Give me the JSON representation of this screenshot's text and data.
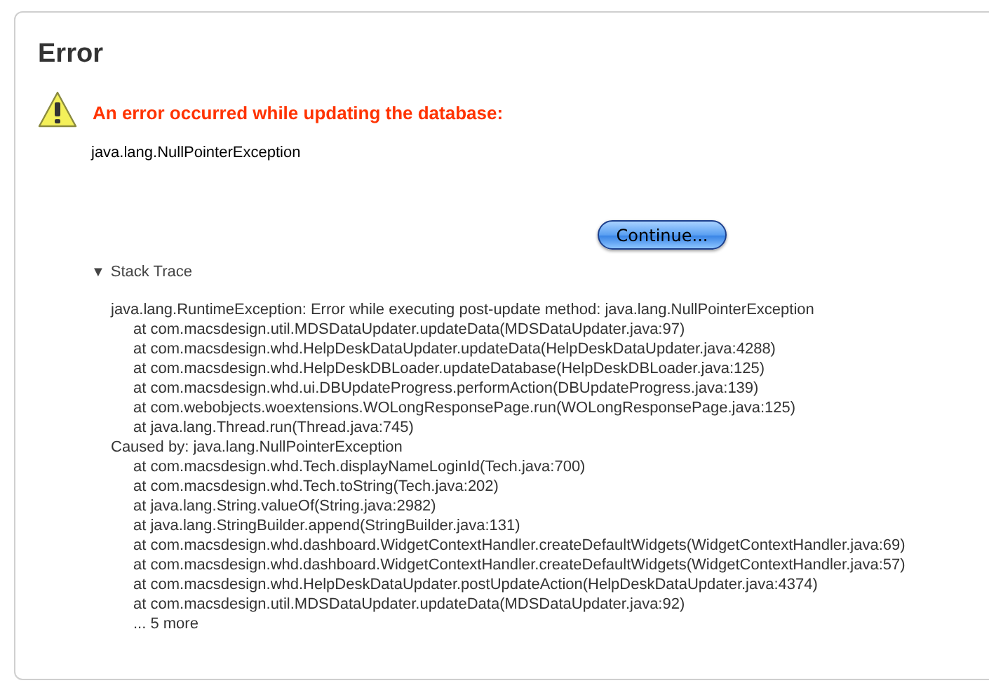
{
  "title": "Error",
  "alert": {
    "message": "An error occurred while updating the database:",
    "detail": "java.lang.NullPointerException"
  },
  "button": "Continue...",
  "stack_trace": {
    "toggle": "▼",
    "label": "Stack Trace",
    "expanded": true,
    "lines": [
      {
        "kind": "exception",
        "text": "java.lang.RuntimeException: Error while executing post-update method: java.lang.NullPointerException"
      },
      {
        "kind": "frame",
        "text": "at com.macsdesign.util.MDSDataUpdater.updateData(MDSDataUpdater.java:97)"
      },
      {
        "kind": "frame",
        "text": "at com.macsdesign.whd.HelpDeskDataUpdater.updateData(HelpDeskDataUpdater.java:4288)"
      },
      {
        "kind": "frame",
        "text": "at com.macsdesign.whd.HelpDeskDBLoader.updateDatabase(HelpDeskDBLoader.java:125)"
      },
      {
        "kind": "frame",
        "text": "at com.macsdesign.whd.ui.DBUpdateProgress.performAction(DBUpdateProgress.java:139)"
      },
      {
        "kind": "frame",
        "text": "at com.webobjects.woextensions.WOLongResponsePage.run(WOLongResponsePage.java:125)"
      },
      {
        "kind": "frame",
        "text": "at java.lang.Thread.run(Thread.java:745)"
      },
      {
        "kind": "exception",
        "text": "Caused by: java.lang.NullPointerException"
      },
      {
        "kind": "frame",
        "text": "at com.macsdesign.whd.Tech.displayNameLoginId(Tech.java:700)"
      },
      {
        "kind": "frame",
        "text": "at com.macsdesign.whd.Tech.toString(Tech.java:202)"
      },
      {
        "kind": "frame",
        "text": "at java.lang.String.valueOf(String.java:2982)"
      },
      {
        "kind": "frame",
        "text": "at java.lang.StringBuilder.append(StringBuilder.java:131)"
      },
      {
        "kind": "frame",
        "text": "at com.macsdesign.whd.dashboard.WidgetContextHandler.createDefaultWidgets(WidgetContextHandler.java:69)"
      },
      {
        "kind": "frame",
        "text": "at com.macsdesign.whd.dashboard.WidgetContextHandler.createDefaultWidgets(WidgetContextHandler.java:57)"
      },
      {
        "kind": "frame",
        "text": "at com.macsdesign.whd.HelpDeskDataUpdater.postUpdateAction(HelpDeskDataUpdater.java:4374)"
      },
      {
        "kind": "frame",
        "text": "at com.macsdesign.util.MDSDataUpdater.updateData(MDSDataUpdater.java:92)"
      },
      {
        "kind": "frame",
        "text": "... 5 more"
      }
    ]
  }
}
